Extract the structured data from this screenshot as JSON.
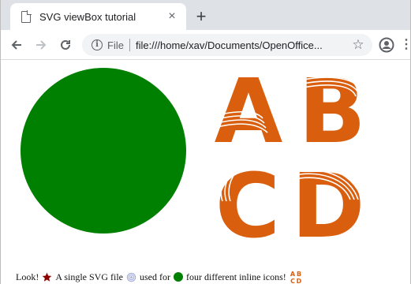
{
  "browser": {
    "tab_title": "SVG viewBox tutorial",
    "close_glyph": "×",
    "new_tab_glyph": "+",
    "scheme_label": "File",
    "url": "file:///home/xav/Documents/OpenOffice...",
    "bookmark_glyph": "☆",
    "menu_glyph": "⋮"
  },
  "page": {
    "letters": [
      "A",
      "B",
      "C",
      "D"
    ],
    "caption": {
      "part1": "Look!",
      "part2": "A single SVG file",
      "part3": "used for",
      "part4": "four different inline icons!"
    },
    "colors": {
      "circle": "#008000",
      "letters": "#d95f0e",
      "star": "#8b0000",
      "file_icon": "#9fa8da"
    }
  }
}
